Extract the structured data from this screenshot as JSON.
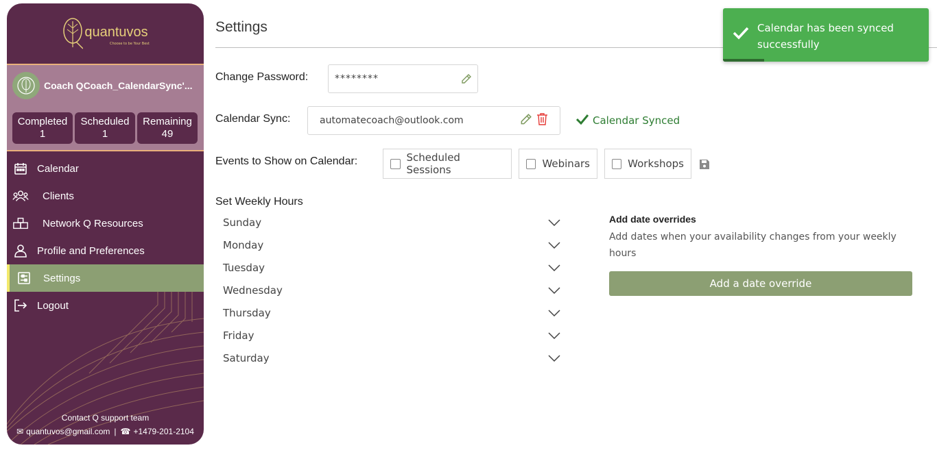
{
  "brand": {
    "name": "quantuvos",
    "tagline": "Choose to be Your Best"
  },
  "coach": {
    "name": "Coach QCoach_CalendarSync'...",
    "stats": [
      {
        "label": "Completed",
        "value": "1"
      },
      {
        "label": "Scheduled",
        "value": "1"
      },
      {
        "label": "Remaining",
        "value": "49"
      }
    ]
  },
  "nav": {
    "items": [
      {
        "label": "Calendar",
        "icon": "calendar-icon"
      },
      {
        "label": "Clients",
        "icon": "users-icon"
      },
      {
        "label": "Network Q Resources",
        "icon": "boxes-icon"
      },
      {
        "label": "Profile and Preferences",
        "icon": "user-icon"
      },
      {
        "label": "Settings",
        "icon": "settings-icon",
        "active": true
      },
      {
        "label": "Logout",
        "icon": "logout-icon"
      }
    ]
  },
  "footer": {
    "title": "Contact Q support team",
    "email": "quantuvos@gmail.com",
    "separator": "|",
    "phone": "+1479-201-2104"
  },
  "page": {
    "title": "Settings"
  },
  "password": {
    "label": "Change Password:",
    "value": "********"
  },
  "calendar_sync": {
    "label": "Calendar Sync:",
    "email": "automatecoach@outlook.com",
    "status": "Calendar Synced"
  },
  "events": {
    "label": "Events to Show on Calendar:",
    "options": [
      {
        "label": "Scheduled Sessions",
        "checked": false
      },
      {
        "label": "Webinars",
        "checked": false
      },
      {
        "label": "Workshops",
        "checked": false
      }
    ]
  },
  "weekly": {
    "title": "Set Weekly Hours",
    "days": [
      "Sunday",
      "Monday",
      "Tuesday",
      "Wednesday",
      "Thursday",
      "Friday",
      "Saturday"
    ]
  },
  "overrides": {
    "title": "Add date overrides",
    "description": "Add dates when your availability changes from your weekly hours",
    "button": "Add a date override"
  },
  "toast": {
    "message": "Calendar has been synced successfully",
    "progress": 0.2
  },
  "colors": {
    "sidebar": "#5a2a4a",
    "accent_green": "#8c9f73",
    "gold": "#e6cf7a",
    "toast": "#4caf50",
    "synced": "#2e7d32"
  }
}
